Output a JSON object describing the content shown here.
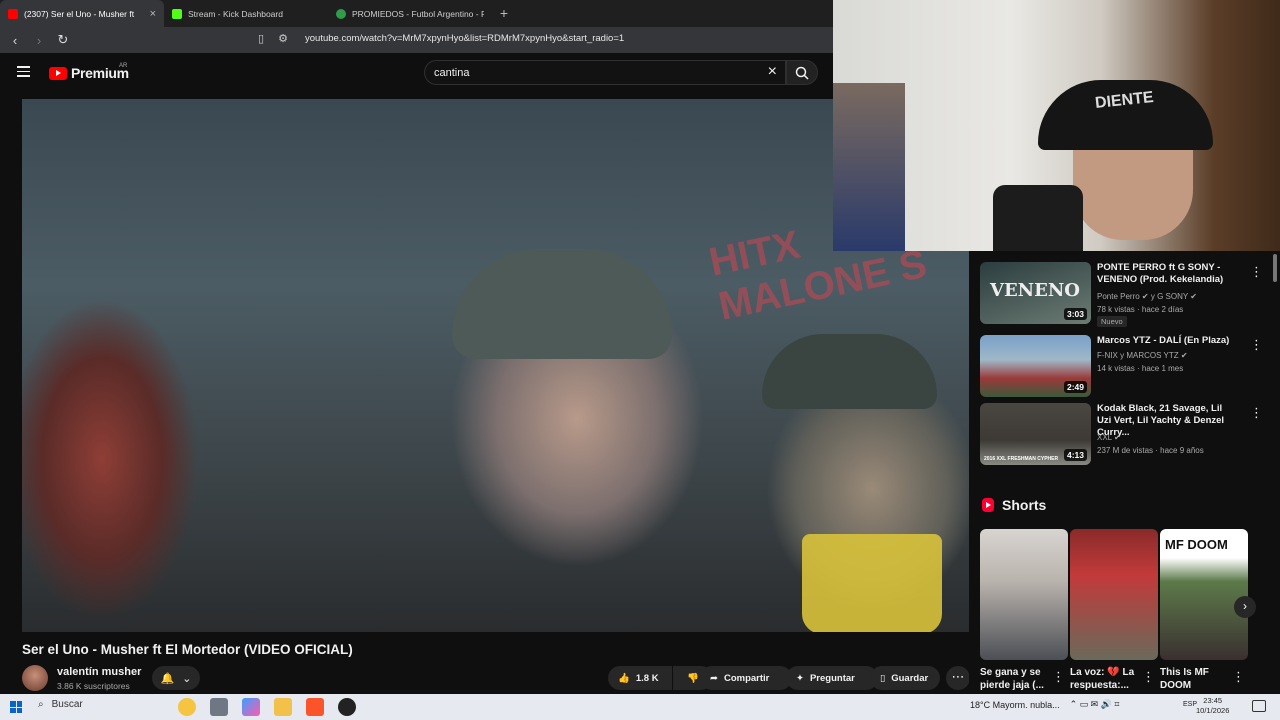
{
  "browser": {
    "tabs": [
      {
        "title": "(2307) Ser el Uno - Musher ft",
        "active": true,
        "color": "#ff0000"
      },
      {
        "title": "Stream - Kick Dashboard",
        "active": false,
        "color": "#53fc18"
      },
      {
        "title": "PROMIEDOS - Futbol Argentino - Fix",
        "active": false,
        "color": "#2e9c4a"
      }
    ],
    "new_tab": "+",
    "tab_close": "×",
    "url": "youtube.com/watch?v=MrM7xpynHyo&list=RDMrM7xpynHyo&start_radio=1"
  },
  "youtube": {
    "logo_text": "Premium",
    "country": "AR",
    "search_value": "cantina",
    "clear_icon": "×"
  },
  "video": {
    "wall_text": "HITX MALONE S",
    "title": "Ser el Uno - Musher ft El Mortedor (VIDEO OFICIAL)",
    "channel": "valentín musher",
    "subscribers": "3.86 K suscriptores",
    "likes": "1.8 K",
    "share": "Compartir",
    "ask": "Preguntar",
    "save": "Guardar",
    "more": "⋯"
  },
  "webcam": {
    "hat_text": "DIENTE"
  },
  "recommended": [
    {
      "title": "PONTE PERRO ft G SONY - VENENO (Prod. Kekelandia)",
      "channel": "Ponte Perro ✔ y G SONY ✔",
      "meta": "78 k vistas · hace 2 días",
      "badge": "Nuevo",
      "duration": "3:03",
      "thumb_text": "VENENO",
      "colors": [
        "#2b3d3f",
        "#6c7b73"
      ]
    },
    {
      "title": "Marcos YTZ - DALÍ (En Plaza)",
      "channel": "F-NIX y MARCOS YTZ ✔",
      "meta": "14 k vistas · hace 1 mes",
      "badge": "",
      "duration": "2:49",
      "thumb_text": "",
      "colors": [
        "#7aa0c8",
        "#9a3a3a"
      ]
    },
    {
      "title": "Kodak Black, 21 Savage, Lil Uzi Vert, Lil Yachty & Denzel Curry...",
      "channel": "XXL ✔",
      "meta": "237 M de vistas · hace 9 años",
      "badge": "",
      "duration": "4:13",
      "thumb_text": "2016 XXL FRESHMAN CYPHER",
      "colors": [
        "#3d3a36",
        "#8a8a84"
      ]
    }
  ],
  "shorts": {
    "heading": "Shorts",
    "items": [
      {
        "caption": "Se gana y se pierde jaja (...",
        "colors": [
          "#b9b3ad",
          "#4c4f55"
        ]
      },
      {
        "caption": "La voz: 💔 La respuesta:...",
        "colors": [
          "#c23a3a",
          "#6a6a5a"
        ]
      },
      {
        "caption": "This Is MF DOOM",
        "label": "MF DOOM",
        "colors": [
          "#5d7a4a",
          "#3a3030"
        ]
      }
    ],
    "next": "›"
  },
  "taskbar": {
    "search": "Buscar",
    "weather": "18°C  Mayorm. nubla...",
    "lang": "ESP",
    "time": "23:45",
    "date": "10/1/2026"
  }
}
